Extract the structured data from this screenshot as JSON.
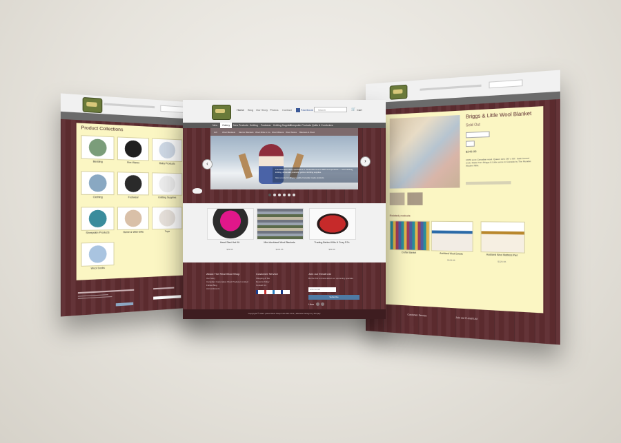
{
  "center": {
    "nav": [
      "Home",
      "Blog",
      "Our Story",
      "Photos",
      "Contact"
    ],
    "facebook_label": "Facebook",
    "search_placeholder": "Search",
    "cart_label": "Cart",
    "tabs": [
      "New",
      "Gallery",
      "New Products",
      "Knitting",
      "Footwear",
      "Knitting Supplies",
      "Sheepskin Products",
      "Quilts & Comforters"
    ],
    "subtabs": [
      "Gift",
      "Wool Blankets",
      "Merino Blankets",
      "Wool Mitts & Co.",
      "Wool Mittens",
      "Wool Stoles",
      "Blankets & Wool"
    ],
    "hero_text_1": "The Real Wool Shop specializes in natural fibers and 100% wool products — wool clothing, knitting, wholesale products, yarns & knitting supplies.",
    "hero_text_2": "Give us a try for all your quality Canadian made products.",
    "products": [
      {
        "name": "Head Start Hat Kit",
        "price": "$39.95"
      },
      {
        "name": "Mini-Auckland Wool Blankets",
        "price": "$134.95"
      },
      {
        "name": "Trading Behind Kilts & Cozy PJ's",
        "price": "$89.99"
      }
    ],
    "footer": {
      "col1_title": "About The Real Wool Shop",
      "col1_items": [
        "Our Story",
        "Canadian Corporation Wool Producer Limited",
        "Follow Blog",
        "Annual Events"
      ],
      "col2_title": "Customer Service",
      "col2_items": [
        "Shipping & Tax",
        "Returns Policy",
        "Contact Us"
      ],
      "col3_title": "Join our Email List",
      "col3_text": "Be the first to know about our upcoming specials.",
      "email_placeholder": "enter email",
      "subscribe_label": "Subscribe",
      "likes_label": "Likes",
      "copyright": "Copyright © 2014 | Real Wool Shop 613-253-4711 | Website Design by Shopify"
    },
    "payment_icons": [
      "visa-icon",
      "mastercard-icon",
      "amex-icon",
      "paypal-icon"
    ]
  },
  "left": {
    "title": "Product Collections",
    "collections": [
      {
        "name": "Bedding"
      },
      {
        "name": "Box Wares"
      },
      {
        "name": "Baby Products"
      },
      {
        "name": "Clothing"
      },
      {
        "name": "Footwear"
      },
      {
        "name": "Knitting Supplies"
      },
      {
        "name": "Sheepskin Products"
      },
      {
        "name": "Home & Wild Gifts"
      },
      {
        "name": "Toys"
      },
      {
        "name": "Wool Socks"
      }
    ]
  },
  "right": {
    "title": "Briggs & Little Wool Blanket",
    "status": "Sold Out",
    "price": "$249.95",
    "desc": "100% pure Canadian wool. Queen size: 90\" x 90\". Satin bound ends. Made from Briggs & Little yarns in Canada by The Ruralist Woolen Mills.",
    "related_title": "Related products",
    "related": [
      {
        "name": "Crofter Blanket"
      },
      {
        "name": "Auckland Wool Duvets",
        "price": "$149.95"
      },
      {
        "name": "Auckland Wool Mattress Pad",
        "price": "$129.95"
      }
    ],
    "footer_col1": "Customer Service",
    "footer_col2": "Join our E-mail List"
  }
}
